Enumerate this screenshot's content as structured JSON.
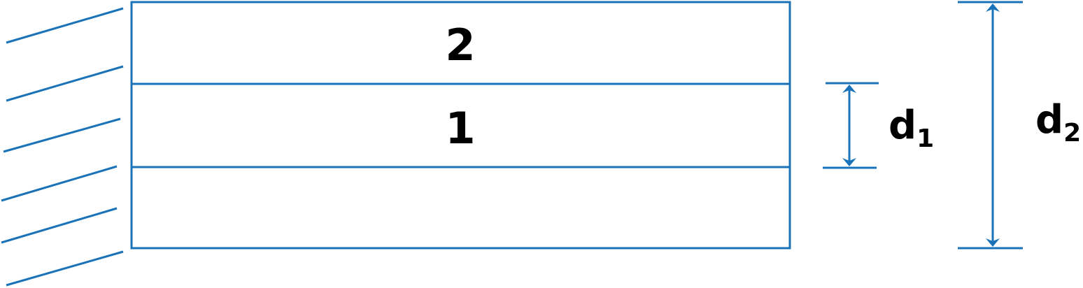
{
  "colors": {
    "stroke": "#1a73b8",
    "text": "#000000"
  },
  "layers": [
    {
      "label": "2"
    },
    {
      "label": "1"
    },
    {
      "label": ""
    }
  ],
  "dimensions": {
    "d1": {
      "symbol": "d",
      "subscript": "1"
    },
    "d2": {
      "symbol": "d",
      "subscript": "2"
    }
  }
}
